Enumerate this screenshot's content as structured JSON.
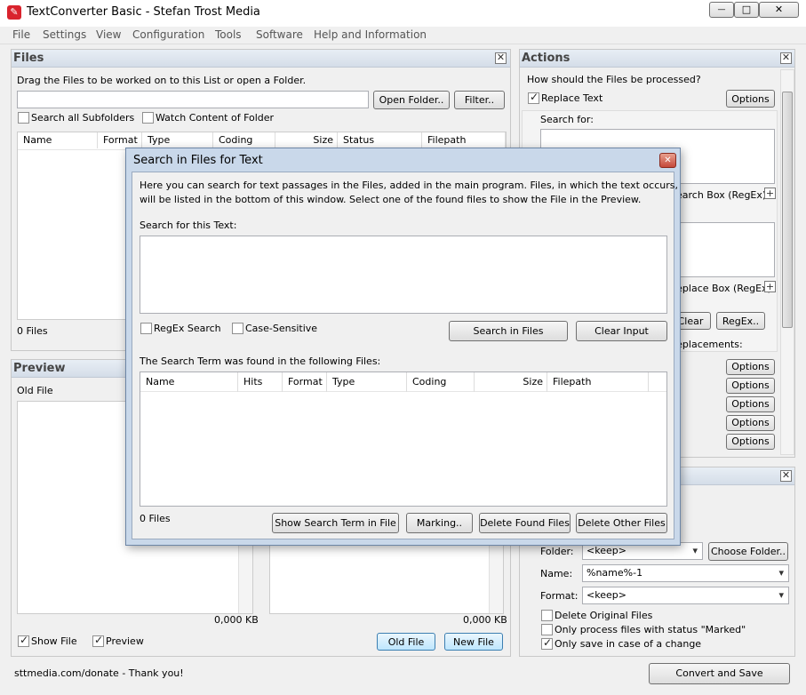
{
  "window": {
    "title": "TextConverter Basic - Stefan Trost Media",
    "minimize": "—",
    "maximize": "□",
    "close": "✕"
  },
  "menu": [
    "File",
    "Settings",
    "View",
    "Configuration",
    "Tools",
    "Software",
    "Help and Information"
  ],
  "files": {
    "title": "Files",
    "hint": "Drag the Files to be worked on to this List or open a Folder.",
    "open_folder": "Open Folder..",
    "filter": "Filter..",
    "search_subfolders": "Search all Subfolders",
    "watch_folder": "Watch Content of Folder",
    "columns": [
      "Name",
      "Format",
      "Type",
      "Coding",
      "Size",
      "Status",
      "Filepath"
    ],
    "count": "0 Files"
  },
  "preview": {
    "title": "Preview",
    "old_file": "Old File",
    "old_size": "0,000 KB",
    "new_size": "0,000 KB",
    "show_file": "Show File",
    "preview_cb": "Preview",
    "old_btn": "Old File",
    "new_btn": "New File"
  },
  "actions": {
    "title": "Actions",
    "question": "How should the Files be processed?",
    "replace_text": "Replace Text",
    "options": "Options",
    "search_for": "Search for:",
    "search_box": "Search Box (RegEx)",
    "replace_box": "Replace Box (RegEx)",
    "clear": "Clear",
    "regex": "RegEx..",
    "replacements": "Replacements:"
  },
  "save": {
    "folder_label": "Folder:",
    "folder_value": "<keep>",
    "choose_folder": "Choose Folder..",
    "name_label": "Name:",
    "name_value": "%name%-1",
    "format_label": "Format:",
    "format_value": "<keep>",
    "delete_original": "Delete Original Files",
    "only_marked": "Only process files with status \"Marked\"",
    "only_change": "Only save in case of a change",
    "convert": "Convert and Save"
  },
  "status": {
    "text": "sttmedia.com/donate - Thank you!"
  },
  "dialog": {
    "title": "Search in Files for Text",
    "intro1": "Here you can search for text passages in the Files, added in the main program. Files, in which the text occurs,",
    "intro2": "will be listed in the bottom of this window. Select one of the found files to show the File in the Preview.",
    "search_label": "Search for this Text:",
    "regex_search": "RegEx Search",
    "case_sensitive": "Case-Sensitive",
    "search_btn": "Search in Files",
    "clear_btn": "Clear Input",
    "found_label": "The Search Term was found in the following Files:",
    "columns": [
      "Name",
      "Hits",
      "Format",
      "Type",
      "Coding",
      "Size",
      "Filepath"
    ],
    "count": "0 Files",
    "show_term": "Show Search Term in File",
    "marking": "Marking..",
    "delete_found": "Delete Found Files",
    "delete_other": "Delete Other Files"
  },
  "colors": {
    "accent": "#3c7fb1",
    "panel_head": "#d4dde8",
    "dialog_frame": "#7a96b8"
  }
}
